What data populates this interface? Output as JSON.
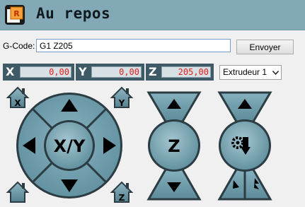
{
  "window": {
    "title": "Au repos"
  },
  "gcode": {
    "label": "G-Code:",
    "value": "G1 Z205",
    "send_label": "Envoyer"
  },
  "axes": [
    {
      "axis": "X",
      "value": "0,00"
    },
    {
      "axis": "Y",
      "value": "0,00"
    },
    {
      "axis": "Z",
      "value": "205,00"
    }
  ],
  "extruder": {
    "selected": "Extrudeur 1"
  },
  "jog": {
    "xy_label": "X/Y",
    "z_label": "Z",
    "home_x_label": "X",
    "home_y_label": "Y",
    "home_z_label": "Z"
  },
  "colors": {
    "header": "#83a9b6",
    "button_fill": "#6d9aa8",
    "button_dark": "#2c3c43",
    "value_text": "#e0201c"
  },
  "icons": [
    "app-icon",
    "home-icon",
    "arrow-up-icon",
    "arrow-down-icon",
    "arrow-left-icon",
    "arrow-right-icon",
    "extrude-icon",
    "gear-icon",
    "chevron-down-icon"
  ]
}
